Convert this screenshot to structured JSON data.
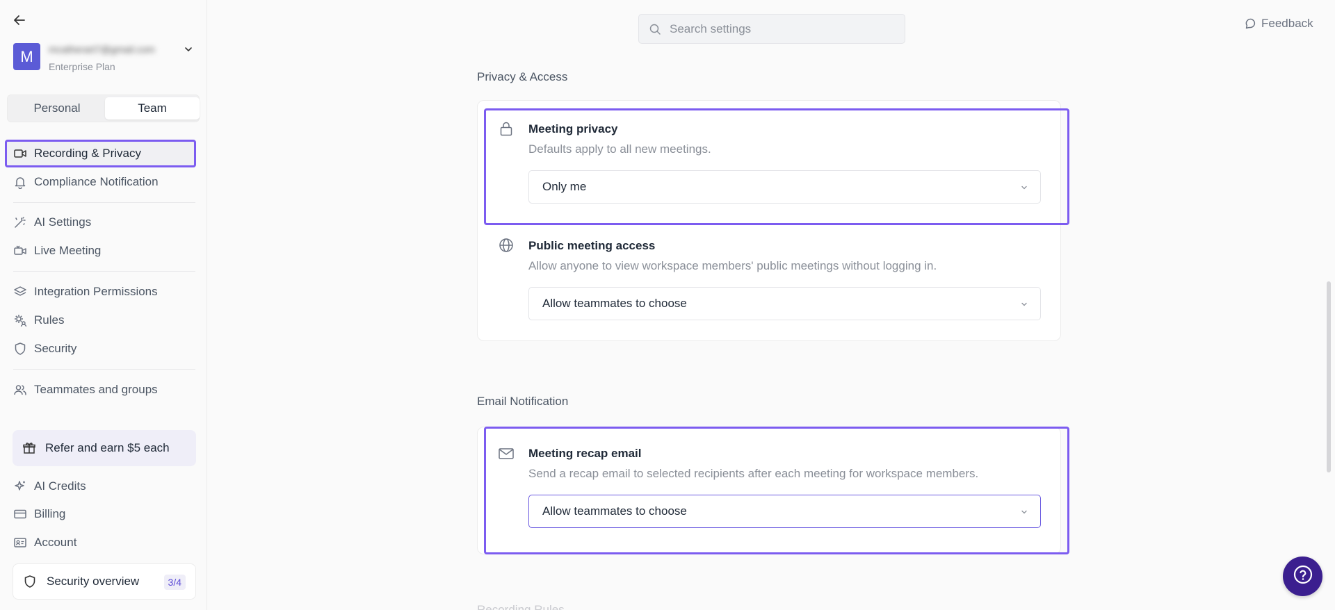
{
  "account": {
    "avatar_letter": "M",
    "email": "mcatherart7@gmail.com",
    "plan": "Enterprise Plan"
  },
  "scope_tabs": [
    {
      "label": "Personal",
      "active": false
    },
    {
      "label": "Team",
      "active": true
    }
  ],
  "nav": [
    {
      "label": "Recording & Privacy",
      "icon": "video-camera-icon",
      "active": true
    },
    {
      "label": "Compliance Notification",
      "icon": "bell-icon"
    },
    {
      "label": "AI Settings",
      "icon": "magic-wand-icon"
    },
    {
      "label": "Live Meeting",
      "icon": "live-camera-icon"
    },
    {
      "label": "Integration Permissions",
      "icon": "layers-icon"
    },
    {
      "label": "Rules",
      "icon": "gear-people-icon"
    },
    {
      "label": "Security",
      "icon": "shield-icon"
    },
    {
      "label": "Teammates and groups",
      "icon": "people-icon"
    }
  ],
  "refer": {
    "label": "Refer and earn $5 each",
    "icon": "gift-icon"
  },
  "bottom_nav": [
    {
      "label": "AI Credits",
      "icon": "sparkle-icon"
    },
    {
      "label": "Billing",
      "icon": "credit-card-icon"
    },
    {
      "label": "Account",
      "icon": "id-card-icon"
    }
  ],
  "security_overview": {
    "label": "Security overview",
    "badge": "3/4"
  },
  "search": {
    "placeholder": "Search settings"
  },
  "feedback": {
    "label": "Feedback"
  },
  "sections": {
    "privacy": {
      "title": "Privacy & Access",
      "settings": [
        {
          "title": "Meeting privacy",
          "description": "Defaults apply to all new meetings.",
          "value": "Only me",
          "icon": "lock-icon"
        },
        {
          "title": "Public meeting access",
          "description": "Allow anyone to view workspace members' public meetings without logging in.",
          "value": "Allow teammates to choose",
          "icon": "globe-icon"
        }
      ]
    },
    "email": {
      "title": "Email Notification",
      "settings": [
        {
          "title": "Meeting recap email",
          "description": "Send a recap email to selected recipients after each meeting for workspace members.",
          "value": "Allow teammates to choose",
          "icon": "mail-icon"
        }
      ]
    },
    "next": {
      "title": "Recording Rules"
    }
  },
  "colors": {
    "accent": "#7c5cf0",
    "avatar": "#5b5bd6",
    "help_button": "#3b1f8f"
  }
}
